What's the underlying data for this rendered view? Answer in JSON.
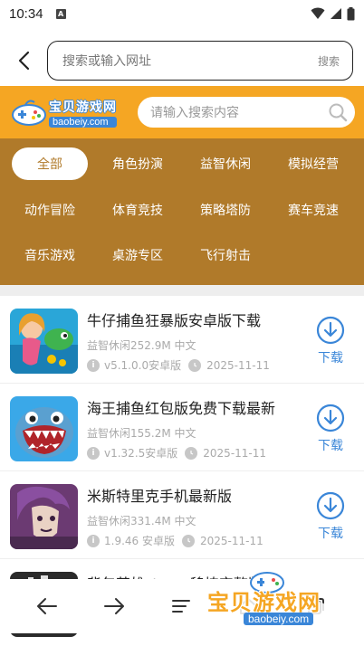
{
  "status": {
    "time": "10:34",
    "badge": "A"
  },
  "browser": {
    "url_placeholder": "搜索或输入网址",
    "search_label": "搜索"
  },
  "site": {
    "logo_cn": "宝贝游戏网",
    "logo_en": "baobeiy.com",
    "search_placeholder": "请输入搜索内容",
    "accent": "#f5a623",
    "panel_color": "#b07a2a",
    "link_color": "#3a86d8"
  },
  "categories": [
    [
      "全部",
      "角色扮演",
      "益智休闲",
      "模拟经营"
    ],
    [
      "动作冒险",
      "体育竞技",
      "策略塔防",
      "赛车竞速"
    ],
    [
      "音乐游戏",
      "桌游专区",
      "飞行射击"
    ]
  ],
  "active_category": "全部",
  "items": [
    {
      "title": "牛仔捕鱼狂暴版安卓版下载",
      "meta": "益智休闲252.9M 中文",
      "version": "v5.1.0.0安卓版",
      "date": "2025-11-11",
      "download": "下载",
      "icon": "mermaid-fish-game-icon"
    },
    {
      "title": "海王捕鱼红包版免费下载最新",
      "meta": "益智休闲155.2M 中文",
      "version": "v1.32.5安卓版",
      "date": "2025-11-11",
      "download": "下载",
      "icon": "shark-game-icon"
    },
    {
      "title": "米斯特里克手机最新版",
      "meta": "益智休闲331.4M 中文",
      "version": "1.9.46 安卓版",
      "date": "2025-11-11",
      "download": "下载",
      "icon": "anime-character-game-icon"
    },
    {
      "title": "背包英雄steam移植完整版",
      "meta": "",
      "version": "",
      "date": "",
      "download": "",
      "icon": "dark-game-icon"
    }
  ],
  "watermark": {
    "cn": "宝贝游戏网",
    "en": "baobeiy.com"
  }
}
